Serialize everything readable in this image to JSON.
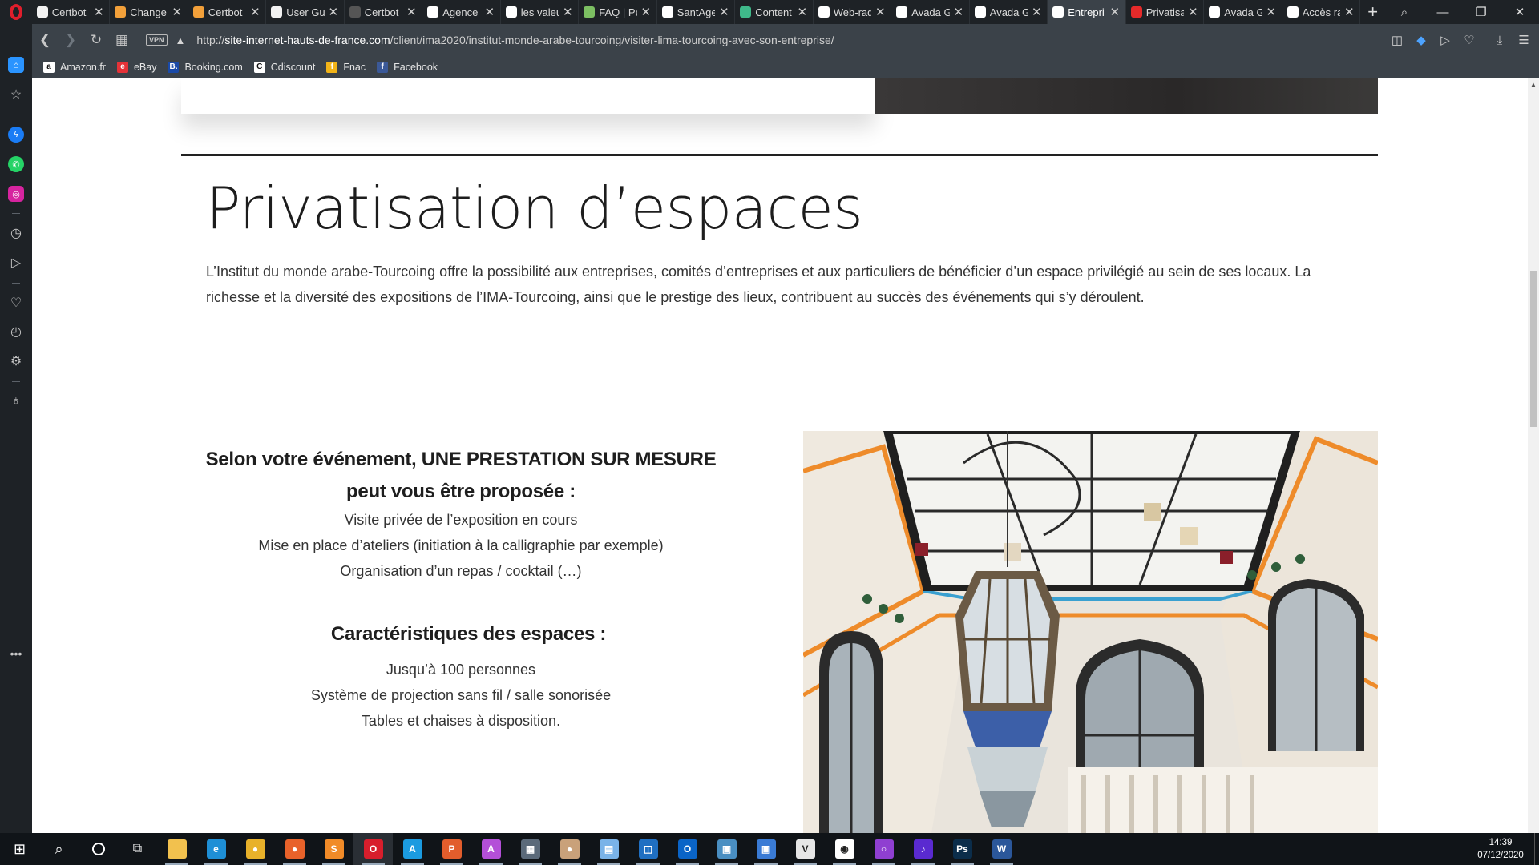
{
  "browser": {
    "tabs": [
      {
        "label": "Certbot",
        "favicon": "certbot-icon",
        "color": "#f2f2f2",
        "active": false
      },
      {
        "label": "Change",
        "favicon": "sun-icon",
        "color": "#f2a03a",
        "active": false
      },
      {
        "label": "Certbot",
        "favicon": "sun-icon",
        "color": "#f2a03a",
        "active": false
      },
      {
        "label": "User Gu",
        "favicon": "certbot-icon",
        "color": "#f2f2f2",
        "active": false
      },
      {
        "label": "Certbot",
        "favicon": "globe-icon",
        "color": "#555555",
        "active": false
      },
      {
        "label": "Agence",
        "favicon": "page-icon",
        "color": "#ffffff",
        "active": false
      },
      {
        "label": "les valeu",
        "favicon": "google-icon",
        "color": "#ffffff",
        "active": false
      },
      {
        "label": "FAQ | Pe",
        "favicon": "image-icon",
        "color": "#7cbf62",
        "active": false
      },
      {
        "label": "SantAge",
        "favicon": "page-icon",
        "color": "#ffffff",
        "active": false
      },
      {
        "label": "Content",
        "favicon": "triangle-icon",
        "color": "#3fb98a",
        "active": false
      },
      {
        "label": "Web-rad",
        "favicon": "page-icon",
        "color": "#ffffff",
        "active": false
      },
      {
        "label": "Avada G",
        "favicon": "page-icon",
        "color": "#ffffff",
        "active": false
      },
      {
        "label": "Avada G",
        "favicon": "page-icon",
        "color": "#ffffff",
        "active": false
      },
      {
        "label": "Entrepri",
        "favicon": "page-icon",
        "color": "#ffffff",
        "active": true
      },
      {
        "label": "Privatisa",
        "favicon": "avada-icon",
        "color": "#e52a2a",
        "active": false
      },
      {
        "label": "Avada G",
        "favicon": "page-icon",
        "color": "#ffffff",
        "active": false
      },
      {
        "label": "Accès ra",
        "favicon": "grid-icon",
        "color": "#ffffff",
        "active": false
      }
    ],
    "address": {
      "vpn_label": "VPN",
      "url_prefix": "http://",
      "url_host": "site-internet-hauts-de-france.com",
      "url_path": "/client/ima2020/institut-monde-arabe-tourcoing/visiter-lima-tourcoing-avec-son-entreprise/"
    },
    "bookmarks": [
      {
        "label": "Amazon.fr",
        "icon": "amazon-icon",
        "color": "#ffffff",
        "glyph": "a"
      },
      {
        "label": "eBay",
        "icon": "ebay-icon",
        "color": "#e53238",
        "glyph": "e"
      },
      {
        "label": "Booking.com",
        "icon": "booking-icon",
        "color": "#1a4aa8",
        "glyph": "B."
      },
      {
        "label": "Cdiscount",
        "icon": "cdiscount-icon",
        "color": "#ffffff",
        "glyph": "C"
      },
      {
        "label": "Fnac",
        "icon": "fnac-icon",
        "color": "#f2b418",
        "glyph": "f"
      },
      {
        "label": "Facebook",
        "icon": "facebook-icon",
        "color": "#3b5998",
        "glyph": "f"
      }
    ]
  },
  "page": {
    "title": "Privatisation d’espaces",
    "intro": "L’Institut du monde arabe-Tourcoing offre la possibilité aux entreprises, comités d’entreprises et aux particuliers de bénéficier d’un espace privilégié au sein de ses locaux. La richesse et la diversité des expositions de l’IMA-Tourcoing, ainsi que le prestige des lieux, contribuent au succès des événements qui s’y déroulent.",
    "prestation_heading": "Selon votre événement, UNE PRESTATION SUR MESURE peut vous être proposée :",
    "prestation_items": [
      "Visite privée de l’exposition en cours",
      "Mise en place d’ateliers (initiation à la calligraphie par exemple)",
      "Organisation d’un repas / cocktail (…)"
    ],
    "characteristics_heading": "Caractéristiques des espaces :",
    "characteristics_items": [
      "Jusqu’à 100 personnes",
      "Système de projection sans fil / salle sonorisée",
      "Tables et chaises à disposition."
    ]
  },
  "taskbar": {
    "apps": [
      {
        "name": "explorer-icon",
        "color": "#f2c14e",
        "glyph": ""
      },
      {
        "name": "edge-icon",
        "color": "#1e8fd6",
        "glyph": "e"
      },
      {
        "name": "chrome-icon",
        "color": "#e8b12a",
        "glyph": "●"
      },
      {
        "name": "firefox-icon",
        "color": "#e8622a",
        "glyph": "●"
      },
      {
        "name": "sublime-icon",
        "color": "#f18b28",
        "glyph": "S"
      },
      {
        "name": "opera-icon",
        "color": "#d81e2c",
        "glyph": "O"
      },
      {
        "name": "affinity-designer-icon",
        "color": "#1b9be0",
        "glyph": "A"
      },
      {
        "name": "affinity-publisher-icon",
        "color": "#e25d2c",
        "glyph": "P"
      },
      {
        "name": "affinity-photo-icon",
        "color": "#b44fd8",
        "glyph": "A"
      },
      {
        "name": "calculator-icon",
        "color": "#5b6a7a",
        "glyph": "▦"
      },
      {
        "name": "paint-icon",
        "color": "#c9a17a",
        "glyph": "●"
      },
      {
        "name": "notepad-icon",
        "color": "#7ab3e8",
        "glyph": "▤"
      },
      {
        "name": "store-icon",
        "color": "#1f6fc2",
        "glyph": "◫"
      },
      {
        "name": "outlook-icon",
        "color": "#0a64c7",
        "glyph": "O"
      },
      {
        "name": "network-icon",
        "color": "#4a8fc2",
        "glyph": "▣"
      },
      {
        "name": "remote-icon",
        "color": "#3a7bd5",
        "glyph": "▣"
      },
      {
        "name": "vnc-icon",
        "color": "#e6e6e6",
        "glyph": "V"
      },
      {
        "name": "media-icon",
        "color": "#ffffff",
        "glyph": "◉"
      },
      {
        "name": "cortana-icon",
        "color": "#8f3fd1",
        "glyph": "○"
      },
      {
        "name": "amazon-music-icon",
        "color": "#5a2ad0",
        "glyph": "♪"
      },
      {
        "name": "photoshop-icon",
        "color": "#0b2d4a",
        "glyph": "Ps"
      },
      {
        "name": "word-icon",
        "color": "#2b579a",
        "glyph": "W"
      }
    ],
    "time": "14:39",
    "date": "07/12/2020"
  }
}
